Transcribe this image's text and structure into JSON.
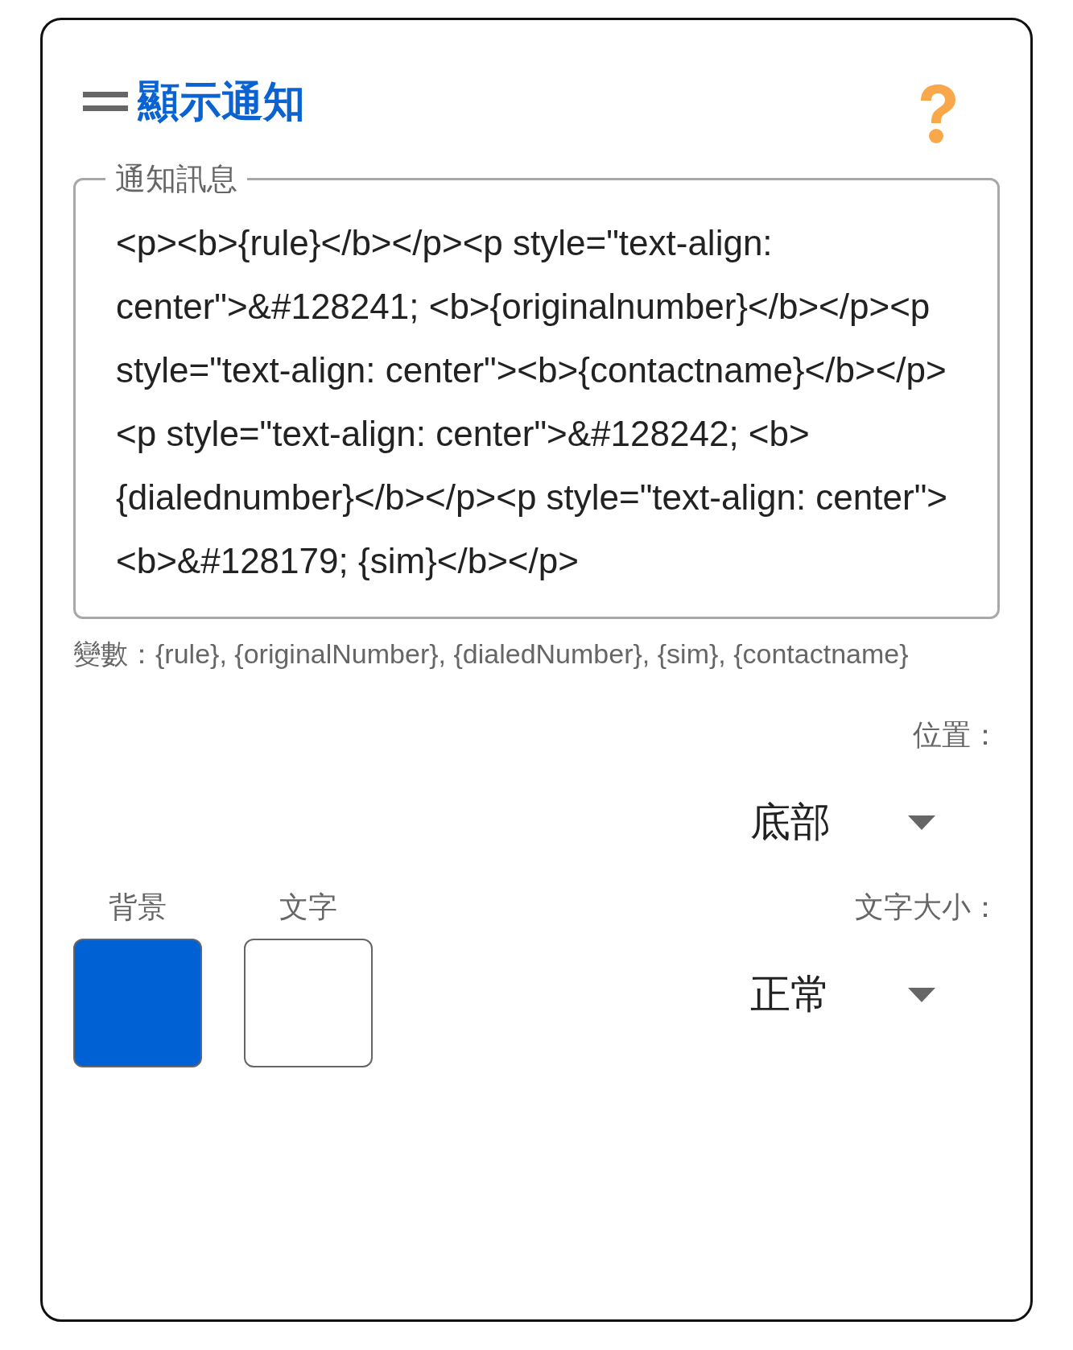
{
  "header": {
    "title": "顯示通知"
  },
  "message": {
    "label": "通知訊息",
    "value": "<p><b>{rule}</b></p><p style=\"text-align: center\">&#128241; <b>{originalnumber}</b></p><p style=\"text-align: center\"><b>{contactname}</b></p><p style=\"text-align: center\">&#128242; <b>{dialednumber}</b></p><p style=\"text-align: center\"><b>&#128179; {sim}</b></p>",
    "helper": "變數：{rule}, {originalNumber}, {dialedNumber}, {sim}, {contactname}"
  },
  "position": {
    "label": "位置：",
    "value": "底部"
  },
  "colors": [
    {
      "label": "背景",
      "color": "#0061d4"
    },
    {
      "label": "文字",
      "color": "#ffffff"
    }
  ],
  "text_size": {
    "label": "文字大小：",
    "value": "正常"
  }
}
